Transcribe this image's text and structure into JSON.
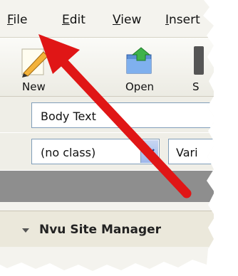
{
  "menu": {
    "file": {
      "label": "File",
      "underline": "F",
      "rest": "ile"
    },
    "edit": {
      "label": "Edit",
      "underline": "E",
      "rest": "dit"
    },
    "view": {
      "label": "View",
      "underline": "V",
      "rest": "iew"
    },
    "insert": {
      "label": "Insert",
      "underline": "I",
      "rest": "nsert"
    }
  },
  "toolbar": {
    "new_label": "New",
    "open_label": "Open",
    "save_label_partial": "S"
  },
  "format": {
    "paragraph_style": "Body Text",
    "class_select": "(no class)",
    "font_select_partial": "Vari"
  },
  "site_manager": {
    "title": "Nvu Site Manager"
  },
  "colors": {
    "arrow": "#e01616",
    "combo_border": "#7f9db9",
    "band": "#8e8e8e"
  },
  "icons": {
    "new": "pencil-new-icon",
    "open": "open-folder-icon",
    "dropdown": "chevron-down-icon",
    "collapse": "triangle-down-icon",
    "annotation": "red-arrow-icon"
  }
}
